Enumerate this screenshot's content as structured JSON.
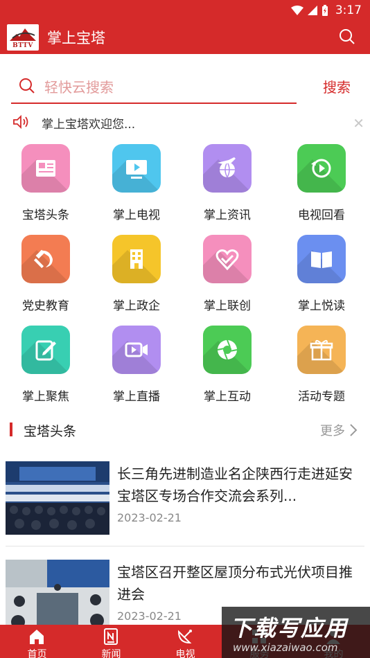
{
  "status_bar": {
    "time": "3:17"
  },
  "app_bar": {
    "logo_text": "BTTV",
    "title": "掌上宝塔"
  },
  "search": {
    "placeholder": "轻快云搜索",
    "button_label": "搜索"
  },
  "notice": {
    "text": "掌上宝塔欢迎您..."
  },
  "grid": [
    {
      "label": "宝塔头条",
      "color": "#f58fbd",
      "icon": "newspaper-icon"
    },
    {
      "label": "掌上电视",
      "color": "#4fc6ee",
      "icon": "tv-icon"
    },
    {
      "label": "掌上资讯",
      "color": "#b18ef0",
      "icon": "plane-globe-icon"
    },
    {
      "label": "电视回看",
      "color": "#4ccb55",
      "icon": "replay-icon"
    },
    {
      "label": "党史教育",
      "color": "#f37c52",
      "icon": "hammer-sickle-icon"
    },
    {
      "label": "掌上政企",
      "color": "#f5c52a",
      "icon": "building-icon"
    },
    {
      "label": "掌上联创",
      "color": "#f58fbd",
      "icon": "heart-icon"
    },
    {
      "label": "掌上悦读",
      "color": "#6b8ff0",
      "icon": "book-icon"
    },
    {
      "label": "掌上聚焦",
      "color": "#38cfb2",
      "icon": "edit-icon"
    },
    {
      "label": "掌上直播",
      "color": "#b18ef0",
      "icon": "video-camera-icon"
    },
    {
      "label": "掌上互动",
      "color": "#4ccb55",
      "icon": "aperture-icon"
    },
    {
      "label": "活动专题",
      "color": "#f5b456",
      "icon": "gift-icon"
    }
  ],
  "section": {
    "title": "宝塔头条",
    "more": "更多"
  },
  "news": [
    {
      "title": "长三角先进制造业名企陕西行走进延安宝塔区专场合作交流会系列...",
      "date": "2023-02-21"
    },
    {
      "title": "宝塔区召开整区屋顶分布式光伏项目推进会",
      "date": "2023-02-21"
    }
  ],
  "tabs": [
    {
      "label": "首页",
      "icon": "home-icon"
    },
    {
      "label": "新闻",
      "icon": "news-icon"
    },
    {
      "label": "电视",
      "icon": "satellite-dish-icon"
    },
    {
      "label": "服务",
      "icon": "grid-icon"
    },
    {
      "label": "我的",
      "icon": "person-icon"
    }
  ],
  "watermark": {
    "main": "下载写应用",
    "url": "www.xiazaiwao.com"
  }
}
